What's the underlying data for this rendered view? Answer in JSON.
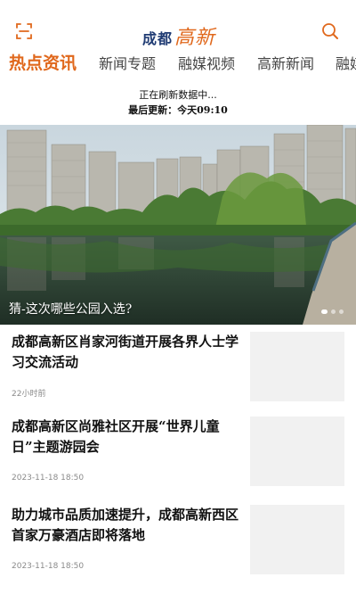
{
  "header": {
    "logo_part1": "成都",
    "logo_part2": "高新"
  },
  "tabs": [
    {
      "label": "热点资讯",
      "active": true
    },
    {
      "label": "新闻专题",
      "active": false
    },
    {
      "label": "融媒视频",
      "active": false
    },
    {
      "label": "高新新闻",
      "active": false
    },
    {
      "label": "融媒",
      "active": false
    }
  ],
  "refresh": {
    "status": "正在刷新数据中...",
    "last_update": "最后更新：今天09:10"
  },
  "banner": {
    "caption": "猜-这次哪些公园入选?",
    "slide_count": 3,
    "current_slide": 1
  },
  "news": [
    {
      "title": "成都高新区肖家河街道开展各界人士学习交流活动",
      "time": "22小时前"
    },
    {
      "title": "成都高新区尚雅社区开展“世界儿童日”主题游园会",
      "time": "2023-11-18 18:50"
    },
    {
      "title": "助力城市品质加速提升，成都高新西区首家万豪酒店即将落地",
      "time": "2023-11-18 18:50"
    }
  ],
  "colors": {
    "accent": "#e0681c",
    "logo_blue": "#1f3b73",
    "thumb_placeholder": "#f1f1f1"
  }
}
